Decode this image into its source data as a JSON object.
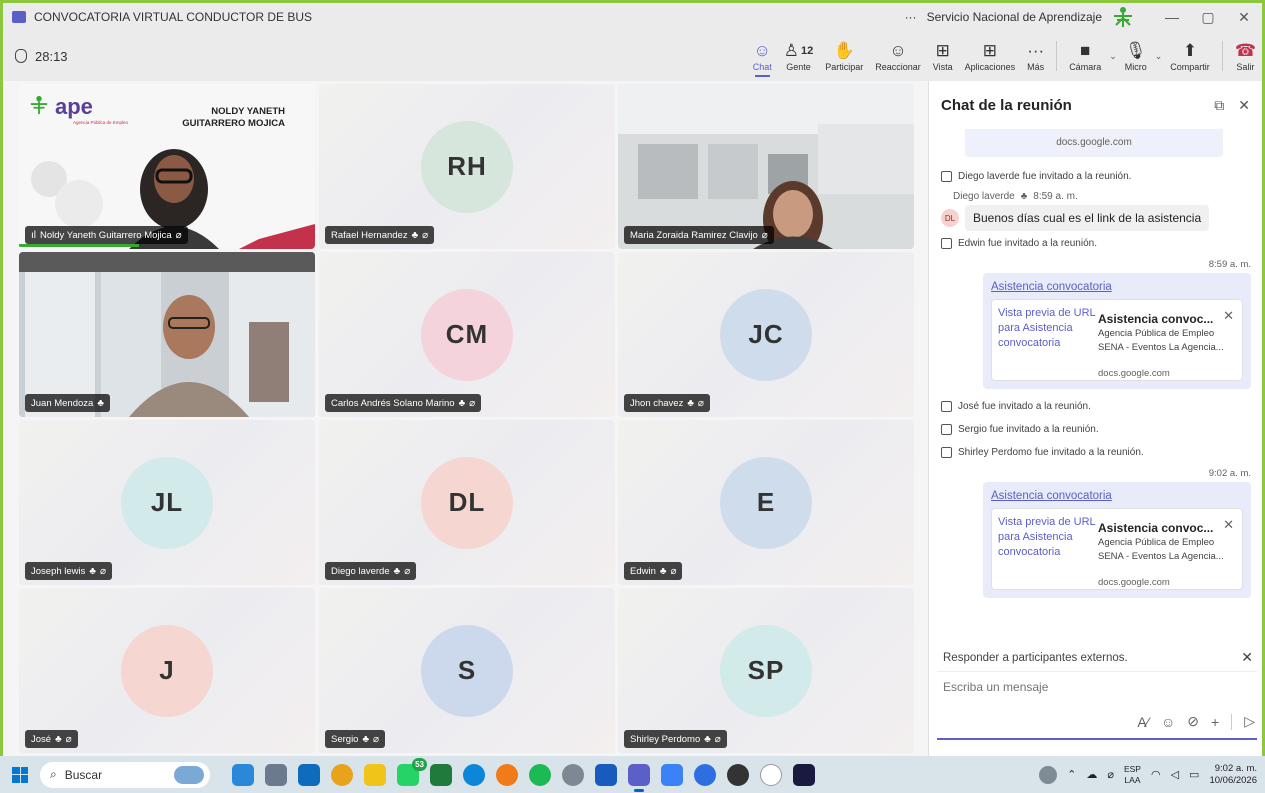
{
  "window": {
    "title": "CONVOCATORIA VIRTUAL CONDUCTOR DE BUS",
    "org": "Servicio Nacional de Aprendizaje",
    "more": "···",
    "minimize": "—",
    "restore": "▢",
    "close": "✕"
  },
  "meeting": {
    "timer": "28:13",
    "tools": {
      "chat": "Chat",
      "people": "Gente",
      "people_count": "12",
      "raise": "Participar",
      "react": "Reaccionar",
      "view": "Vista",
      "apps": "Aplicaciones",
      "more": "Más",
      "camera": "Cámara",
      "mic": "Micro",
      "share": "Compartir",
      "leave": "Salir"
    }
  },
  "tiles": {
    "t1": {
      "name": "Noldy Yaneth Guitarrero Mojica",
      "slide_logo": "ape",
      "slide_sub": "Agencia Pública de Empleo",
      "slide_name_1": "NOLDY YANETH",
      "slide_name_2": "GUITARRERO MOJICA"
    },
    "t2": {
      "name": "Rafael Hernandez",
      "initials": "RH",
      "color": "#d6e6dc"
    },
    "t3": {
      "name": "Maria Zoraida Ramirez Clavijo"
    },
    "t4": {
      "name": "Juan Mendoza"
    },
    "t5": {
      "name": "Carlos Andrés Solano Marino",
      "initials": "CM",
      "color": "#f5d3dc"
    },
    "t6": {
      "name": "Jhon chavez",
      "initials": "JC",
      "color": "#cfdcec"
    },
    "t7": {
      "name": "Joseph lewis",
      "initials": "JL",
      "color": "#d3eaea"
    },
    "t8": {
      "name": "Diego laverde",
      "initials": "DL",
      "color": "#f6d6d0"
    },
    "t9": {
      "name": "Edwin",
      "initials": "E",
      "color": "#cfdcec"
    },
    "t10": {
      "name": "José",
      "initials": "J",
      "color": "#f6d6d0"
    },
    "t11": {
      "name": "Sergio",
      "initials": "S",
      "color": "#ccd9ec"
    },
    "t12": {
      "name": "Shirley Perdomo",
      "initials": "SP",
      "color": "#d3eaea"
    }
  },
  "chat": {
    "title": "Chat de la reunión",
    "top_card_domain": "docs.google.com",
    "sys1": "Diego laverde  fue invitado a la reunión.",
    "msg_author": "Diego laverde",
    "msg_time": "8:59 a. m.",
    "msg_avatar": "DL",
    "msg_text": "Buenos días cual es el link de la asistencia",
    "sys2": "Edwin  fue invitado a la reunión.",
    "own1_time": "8:59 a. m.",
    "link_text": "Asistencia convocatoria",
    "preview_alt": "Vista previa de URL para Asistencia convocatoria",
    "preview_title": "Asistencia convoc...",
    "preview_desc_1": "Agencia Pública de Empleo",
    "preview_desc_2": "SENA - Eventos La Agencia...",
    "preview_domain": "docs.google.com",
    "sys3": "José  fue invitado a la reunión.",
    "sys4": "Sergio  fue invitado a la reunión.",
    "sys5": "Shirley Perdomo  fue invitado a la reunión.",
    "own2_time": "9:02 a. m.",
    "external_notice": "Responder a participantes externos.",
    "input_placeholder": "Escriba un mensaje"
  },
  "taskbar": {
    "search_label": "Buscar",
    "whatsapp_badge": "53",
    "lang_1": "ESP",
    "lang_2": "LAA",
    "time": "9:02 a. m.",
    "date": "10/06/2026"
  }
}
